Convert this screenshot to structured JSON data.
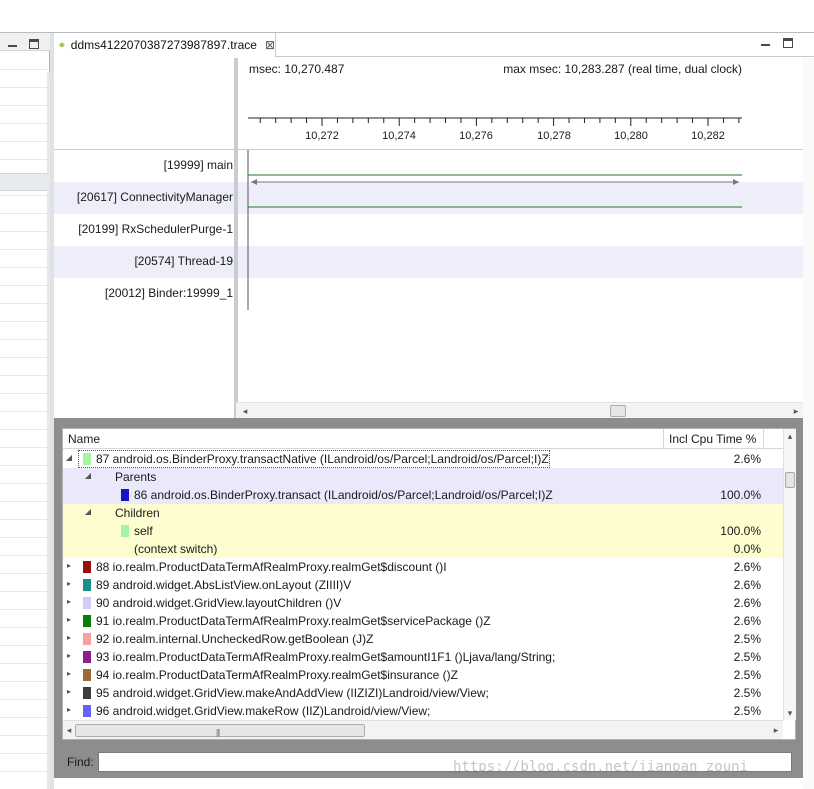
{
  "tab": {
    "title": "ddms4122070387273987897.trace",
    "close": "⊠"
  },
  "timeline": {
    "msec": "msec: 10,270.487",
    "max_msec": "max msec: 10,283.287 (real time, dual clock)",
    "ticks": [
      "10,272",
      "10,274",
      "10,276",
      "10,278",
      "10,280",
      "10,282"
    ],
    "threads": [
      {
        "label": "[19999] main"
      },
      {
        "label": "[20617] ConnectivityManager"
      },
      {
        "label": "[20199] RxSchedulerPurge-1"
      },
      {
        "label": "[20574] Thread-19"
      },
      {
        "label": "[20012] Binder:19999_1"
      }
    ]
  },
  "table": {
    "col_name": "Name",
    "col_incl": "Incl Cpu Time %",
    "rows": [
      {
        "label": "87 android.os.BinderProxy.transactNative (ILandroid/os/Parcel;Landroid/os/Parcel;I)Z",
        "pct": "2.6%",
        "color": "#a3f5a3"
      },
      {
        "label": "Parents",
        "pct": ""
      },
      {
        "label": "86 android.os.BinderProxy.transact (ILandroid/os/Parcel;Landroid/os/Parcel;I)Z",
        "pct": "100.0%",
        "color": "#1b12c4"
      },
      {
        "label": "Children",
        "pct": ""
      },
      {
        "label": "self",
        "pct": "100.0%",
        "color": "#a3f5a3"
      },
      {
        "label": "(context switch)",
        "pct": "0.0%"
      },
      {
        "label": "88 io.realm.ProductDataTermAfRealmProxy.realmGet$discount ()I",
        "pct": "2.6%",
        "color": "#9b0f0f"
      },
      {
        "label": "89 android.widget.AbsListView.onLayout (ZIIII)V",
        "pct": "2.6%",
        "color": "#1c8f86"
      },
      {
        "label": "90 android.widget.GridView.layoutChildren ()V",
        "pct": "2.6%",
        "color": "#cfcdfb"
      },
      {
        "label": "91 io.realm.ProductDataTermAfRealmProxy.realmGet$servicePackage ()Z",
        "pct": "2.6%",
        "color": "#0b7a0b"
      },
      {
        "label": "92 io.realm.internal.UncheckedRow.getBoolean (J)Z",
        "pct": "2.5%",
        "color": "#f6a0a0"
      },
      {
        "label": "93 io.realm.ProductDataTermAfRealmProxy.realmGet$amountI1F1 ()Ljava/lang/String;",
        "pct": "2.5%",
        "color": "#8e1d8e"
      },
      {
        "label": "94 io.realm.ProductDataTermAfRealmProxy.realmGet$insurance ()Z",
        "pct": "2.5%",
        "color": "#9a6a3a"
      },
      {
        "label": "95 android.widget.GridView.makeAndAddView (IIZIZI)Landroid/view/View;",
        "pct": "2.5%",
        "color": "#3c3c3c"
      },
      {
        "label": "96 android.widget.GridView.makeRow (IIZ)Landroid/view/View;",
        "pct": "2.5%",
        "color": "#6363f7"
      }
    ]
  },
  "find": {
    "label": "Find:",
    "value": ""
  },
  "watermark": "https://blog.csdn.net/jianpan_zouni"
}
